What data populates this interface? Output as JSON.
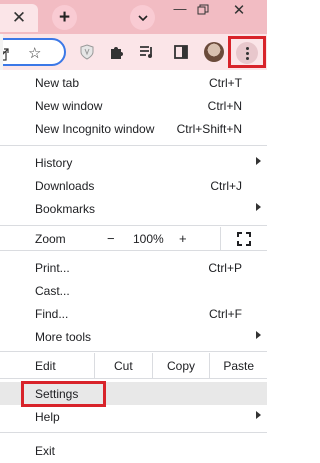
{
  "titlebar": {
    "tab_close_glyph": "✕",
    "new_tab_glyph": "+",
    "tab_search_glyph": "⌄",
    "minimize_glyph": "—",
    "close_glyph": "✕"
  },
  "toolbar": {
    "star_glyph": "☆"
  },
  "menu": {
    "new_tab": {
      "label": "New tab",
      "shortcut": "Ctrl+T"
    },
    "new_window": {
      "label": "New window",
      "shortcut": "Ctrl+N"
    },
    "new_incognito": {
      "label": "New Incognito window",
      "shortcut": "Ctrl+Shift+N"
    },
    "history": {
      "label": "History"
    },
    "downloads": {
      "label": "Downloads",
      "shortcut": "Ctrl+J"
    },
    "bookmarks": {
      "label": "Bookmarks"
    },
    "zoom": {
      "label": "Zoom",
      "minus": "−",
      "value": "100%",
      "plus": "+"
    },
    "print": {
      "label": "Print...",
      "shortcut": "Ctrl+P"
    },
    "cast": {
      "label": "Cast..."
    },
    "find": {
      "label": "Find...",
      "shortcut": "Ctrl+F"
    },
    "more_tools": {
      "label": "More tools"
    },
    "edit": {
      "label": "Edit",
      "cut": "Cut",
      "copy": "Copy",
      "paste": "Paste"
    },
    "settings": {
      "label": "Settings"
    },
    "help": {
      "label": "Help"
    },
    "exit": {
      "label": "Exit"
    }
  },
  "colors": {
    "titlebar": "#f2bcc3",
    "toolbar": "#fbe5e8",
    "highlight_box": "#d8232a",
    "omnibox_border": "#3b78e7"
  }
}
